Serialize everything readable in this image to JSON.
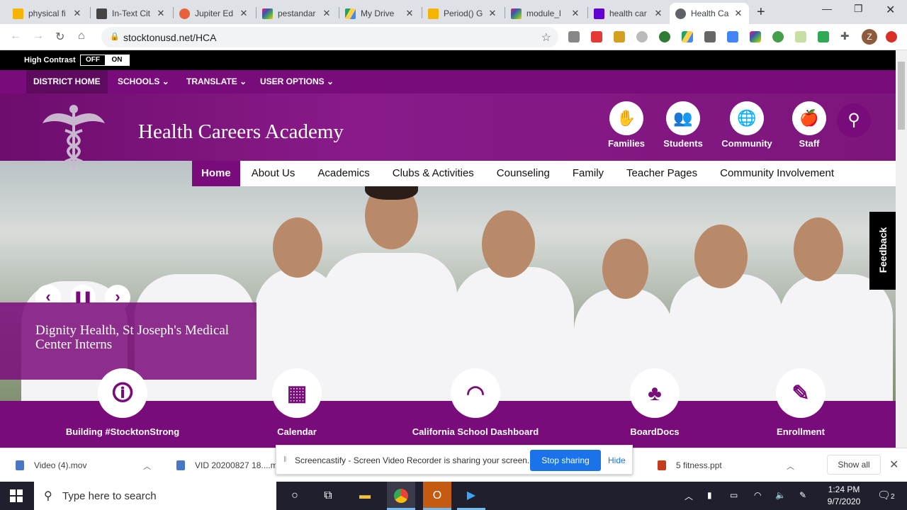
{
  "browser": {
    "tabs": [
      {
        "title": "physical fi",
        "color": "#f5b400"
      },
      {
        "title": "In-Text Cit",
        "color": "#444444"
      },
      {
        "title": "Jupiter Ed",
        "color": "#e8603c"
      },
      {
        "title": "pestandar",
        "color": "#e91e63"
      },
      {
        "title": "My Drive",
        "color": "#1fa463"
      },
      {
        "title": "Period() G",
        "color": "#f5b400"
      },
      {
        "title": "module_l",
        "color": "#e91e63"
      },
      {
        "title": "health car",
        "color": "#6001d2"
      },
      {
        "title": "Health Ca",
        "color": "#5f6368"
      }
    ],
    "new_tab": "+",
    "url": "stocktonusd.net/HCA",
    "profile_initial": "Z"
  },
  "site": {
    "high_contrast_label": "High Contrast",
    "hc_off": "OFF",
    "hc_on": "ON",
    "top_nav": [
      "DISTRICT HOME",
      "SCHOOLS",
      "TRANSLATE",
      "USER OPTIONS"
    ],
    "school_name": "Health Careers Academy",
    "quick_links": [
      "Families",
      "Students",
      "Community",
      "Staff"
    ],
    "main_nav": [
      "Home",
      "About Us",
      "Academics",
      "Clubs & Activities",
      "Counseling",
      "Family",
      "Teacher Pages",
      "Community Involvement"
    ],
    "slide_caption": "Dignity Health, St Joseph's Medical Center Interns",
    "feedback": "Feedback",
    "footer_links": [
      "Building #StocktonStrong",
      "Calendar",
      "California School Dashboard",
      "BoardDocs",
      "Enrollment"
    ]
  },
  "downloads": {
    "items": [
      "Video (4).mov",
      "VID 20200827 18....m",
      "5 fitness.ppt"
    ],
    "show_all": "Show all"
  },
  "screencastify": {
    "message": "Screencastify - Screen Video Recorder is sharing your screen.",
    "stop": "Stop sharing",
    "hide": "Hide"
  },
  "taskbar": {
    "search_placeholder": "Type here to search",
    "time": "1:24 PM",
    "date": "9/7/2020",
    "notification_count": "2"
  }
}
